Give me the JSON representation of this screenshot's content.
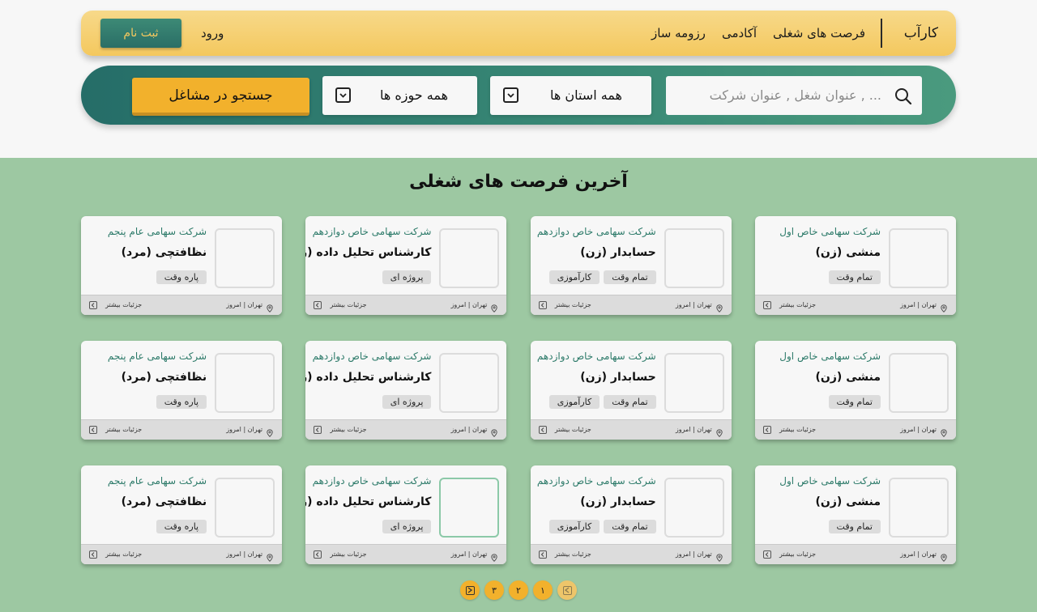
{
  "nav": {
    "brand": "کارآب",
    "links": [
      "فرصت های شغلی",
      "آکادمی",
      "رزومه ساز"
    ],
    "login": "ورود",
    "register": "ثبت نام"
  },
  "search": {
    "placeholder": "عنوان شغل , عنوان شرکت , ...",
    "province": "همه استان ها",
    "field": "همه حوزه ها",
    "button": "جستجو در مشاغل"
  },
  "section_title": "آخرین فرصت های شغلی",
  "card_common": {
    "location": "تهران | امروز",
    "more": "جزئیات بیشتر"
  },
  "jobs": [
    {
      "company": "شرکت سهامی خاص اول",
      "title": "منشی (زن)",
      "tags": [
        "تمام وقت"
      ]
    },
    {
      "company": "شرکت سهامی خاص دوازدهم",
      "title": "حسابدار (زن)",
      "tags": [
        "تمام وقت",
        "کارآموزی"
      ]
    },
    {
      "company": "شرکت سهامی خاص دوازدهم",
      "title": "کارشناس تحلیل داده (زن)",
      "tags": [
        "پروژه ای"
      ]
    },
    {
      "company": "شرکت سهامی عام پنجم",
      "title": "نظافتچی (مرد)",
      "tags": [
        "پاره وقت"
      ]
    },
    {
      "company": "شرکت سهامی خاص اول",
      "title": "منشی (زن)",
      "tags": [
        "تمام وقت"
      ]
    },
    {
      "company": "شرکت سهامی خاص دوازدهم",
      "title": "حسابدار (زن)",
      "tags": [
        "تمام وقت",
        "کارآموزی"
      ]
    },
    {
      "company": "شرکت سهامی خاص دوازدهم",
      "title": "کارشناس تحلیل داده (زن)",
      "tags": [
        "پروژه ای"
      ]
    },
    {
      "company": "شرکت سهامی عام پنجم",
      "title": "نظافتچی (مرد)",
      "tags": [
        "پاره وقت"
      ]
    },
    {
      "company": "شرکت سهامی خاص اول",
      "title": "منشی (زن)",
      "tags": [
        "تمام وقت"
      ]
    },
    {
      "company": "شرکت سهامی خاص دوازدهم",
      "title": "حسابدار (زن)",
      "tags": [
        "تمام وقت",
        "کارآموزی"
      ]
    },
    {
      "company": "شرکت سهامی خاص دوازدهم",
      "title": "کارشناس تحلیل داده (زن)",
      "tags": [
        "پروژه ای"
      ],
      "highlighted": true
    },
    {
      "company": "شرکت سهامی عام پنجم",
      "title": "نظافتچی (مرد)",
      "tags": [
        "پاره وقت"
      ]
    }
  ],
  "pagination": {
    "pages": [
      "۱",
      "۲",
      "۳"
    ],
    "prev_icon": "prev-icon",
    "next_icon": "next-icon"
  },
  "colors": {
    "nav_yellow": "#f4c85e",
    "teal": "#2a6e66",
    "section_green": "#9dc8a2",
    "accent_orange": "#f2b12c",
    "company_teal": "#2c7a69"
  }
}
